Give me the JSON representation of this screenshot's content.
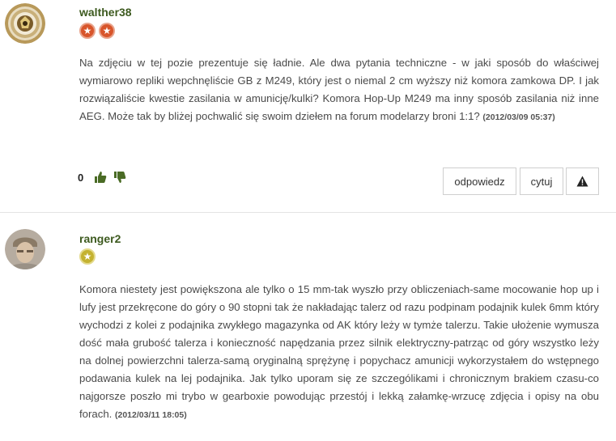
{
  "comments": [
    {
      "username": "walther38",
      "badges": [
        "star-badge-orange",
        "star-badge-orange"
      ],
      "text": "Na zdjęciu w tej pozie prezentuje się ładnie. Ale dwa pytania techniczne - w jaki sposób do właściwej wymiarowo repliki wepchnęliście GB z M249, który jest o niemal 2 cm wyższy niż komora zamkowa DP. I jak rozwiązaliście kwestie zasilania w amunicję/kulki? Komora Hop-Up M249 ma inny sposób zasilania niż inne AEG. Może tak by bliżej pochwalić się swoim dziełem na forum modelarzy broni 1:1?",
      "timestamp": "(2012/03/09 05:37)",
      "vote_count": "0",
      "actions": {
        "reply": "odpowiedz",
        "quote": "cytuj",
        "report_icon": "warning-icon"
      }
    },
    {
      "username": "ranger2",
      "badges": [
        "star-badge-gold"
      ],
      "text": "Komora niestety jest powiększona ale tylko o 15 mm-tak wyszło przy obliczeniach-same mocowanie hop up i lufy jest przekręcone do góry o 90 stopni tak że nakładając talerz od razu podpinam podajnik kulek 6mm który wychodzi z kolei z podajnika zwykłego magazynka od AK który leży w tymże talerzu. Takie ułożenie wymusza dość mała grubość talerza i konieczność napędzania przez silnik elektryczny-patrząc od góry wszystko leży na dolnej powierzchni talerza-samą oryginalną sprężynę i popychacz amunicji wykorzystałem do wstępnego podawania kulek na lej podajnika. Jak tylko uporam się ze szczególikami i chronicznym brakiem czasu-co najgorsze poszło mi trybo w gearboxie powodując przestój i lekką załamkę-wrzucę zdjęcia i opisy na obu forach.",
      "timestamp": "(2012/03/11 18:05)"
    }
  ],
  "colors": {
    "username": "#3d5a1f",
    "thumb": "#4a6b25",
    "badge_orange": "#d8552b",
    "badge_gold": "#c4b230"
  }
}
